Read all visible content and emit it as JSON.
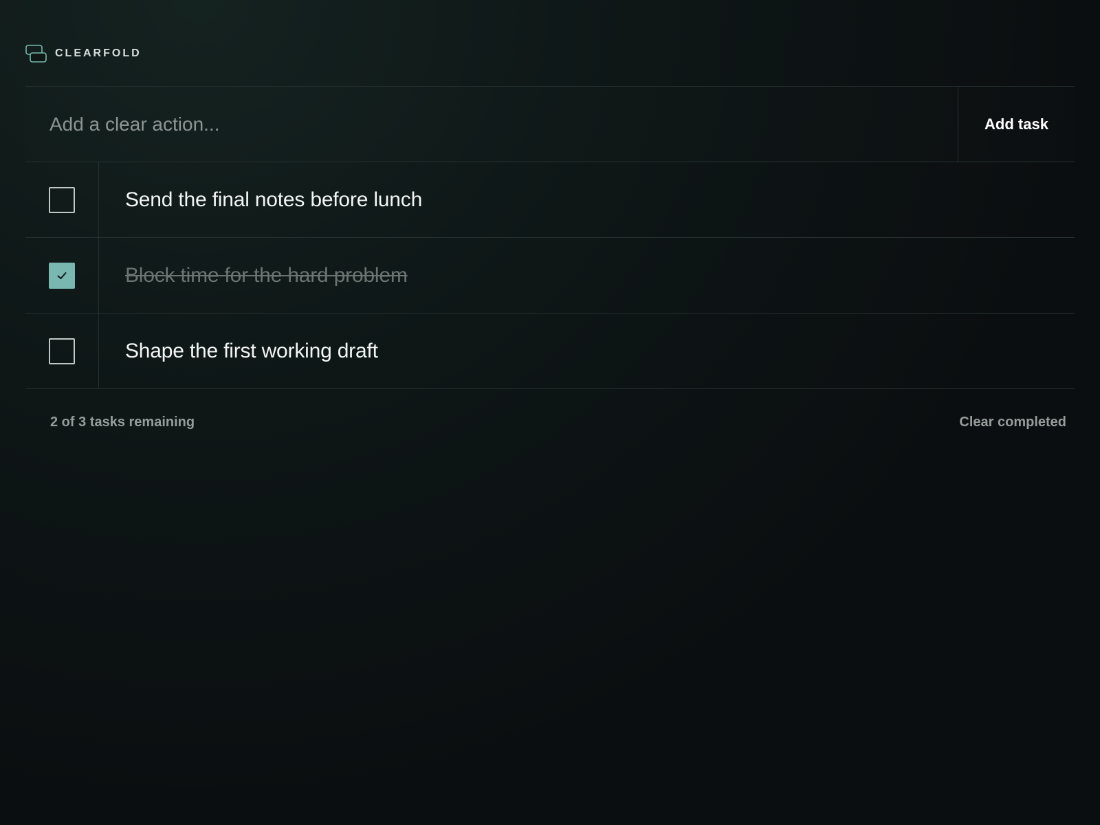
{
  "brand": {
    "name": "CLEARFOLD",
    "icon": "stacked-folds-icon",
    "accent_color": "#79b8b0"
  },
  "composer": {
    "placeholder": "Add a clear action...",
    "value": "",
    "add_label": "Add task"
  },
  "tasks": [
    {
      "label": "Send the final notes before lunch",
      "completed": false
    },
    {
      "label": "Block time for the hard problem",
      "completed": true
    },
    {
      "label": "Shape the first working draft",
      "completed": false
    }
  ],
  "footer": {
    "remaining": "2 of 3 tasks remaining",
    "clear_label": "Clear completed"
  }
}
